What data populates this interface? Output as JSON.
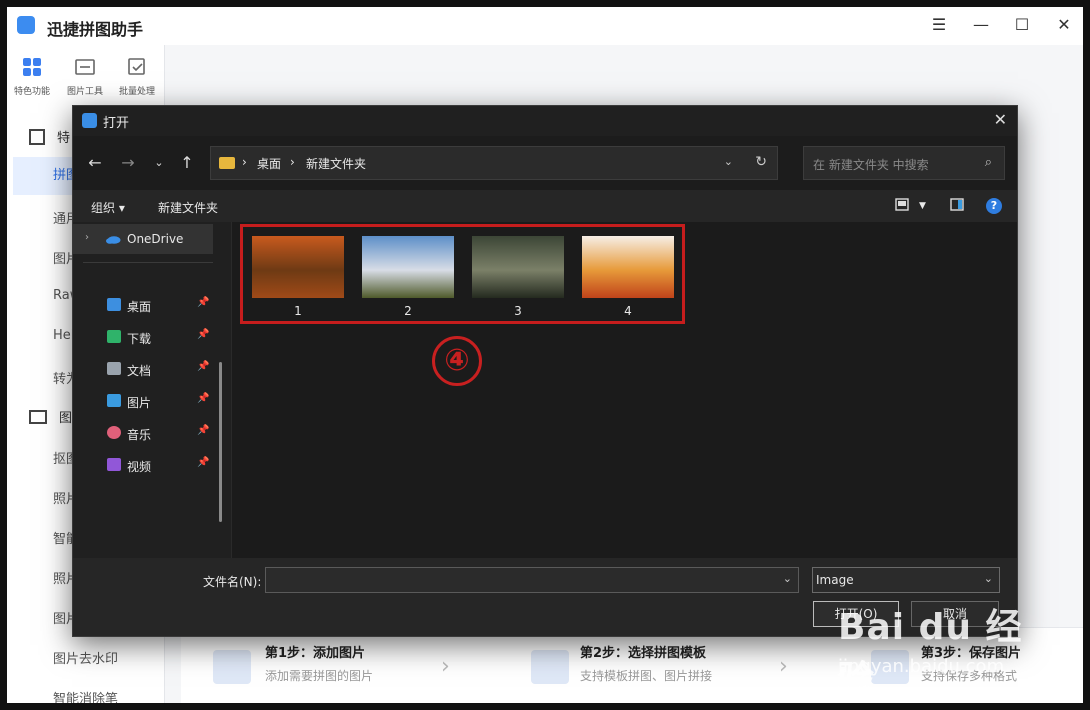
{
  "app": {
    "title": "迅捷拼图助手",
    "top_tabs": [
      "特色功能",
      "图片工具",
      "批量处理"
    ],
    "sections": [
      {
        "label": "特",
        "items": [
          "拼图",
          "通用",
          "图片",
          "Raw",
          "Hei",
          "转为"
        ]
      },
      {
        "label": "图",
        "items": [
          "抠图",
          "照片",
          "智能",
          "照片",
          "图片",
          "图片去水印",
          "智能消除笔"
        ]
      }
    ],
    "steps": [
      {
        "title": "第1步：添加图片",
        "desc": "添加需要拼图的图片"
      },
      {
        "title": "第2步：选择拼图模板",
        "desc": "支持模板拼图、图片拼接"
      },
      {
        "title": "第3步：保存图片",
        "desc": "支持保存多种格式"
      }
    ]
  },
  "dialog": {
    "title": "打开",
    "breadcrumb": [
      "桌面",
      "新建文件夹"
    ],
    "search_placeholder": "在 新建文件夹 中搜索",
    "toolbar": {
      "organize": "组织 ▾",
      "new_folder": "新建文件夹"
    },
    "nav": {
      "onedrive": "OneDrive",
      "quick_access": [
        {
          "label": "桌面",
          "icon": "desktop-icon",
          "color": "#3d8fe0"
        },
        {
          "label": "下载",
          "icon": "download-icon",
          "color": "#2fb36a"
        },
        {
          "label": "文档",
          "icon": "document-icon",
          "color": "#9aa3ad"
        },
        {
          "label": "图片",
          "icon": "pictures-icon",
          "color": "#3a9be0"
        },
        {
          "label": "音乐",
          "icon": "music-icon",
          "color": "#e0607a"
        },
        {
          "label": "视频",
          "icon": "video-icon",
          "color": "#9157d8"
        }
      ]
    },
    "files": [
      {
        "name": "1",
        "colors": [
          "#c85a1e",
          "#6e3a14",
          "#a04a18"
        ]
      },
      {
        "name": "2",
        "colors": [
          "#5d8fc8",
          "#d8dde6",
          "#4f5a2a"
        ]
      },
      {
        "name": "3",
        "colors": [
          "#3c4636",
          "#7b8068",
          "#242a1f"
        ]
      },
      {
        "name": "4",
        "colors": [
          "#f6eee6",
          "#e79a3a",
          "#c0431a"
        ]
      }
    ],
    "annotation": "④",
    "filename_label": "文件名(N):",
    "filename_value": "",
    "filetype": "Image",
    "open_label": "打开(O)",
    "cancel_label": "取消"
  },
  "watermark": {
    "main": "Bai du 经验",
    "sub": "jingyan.baidu.com"
  }
}
